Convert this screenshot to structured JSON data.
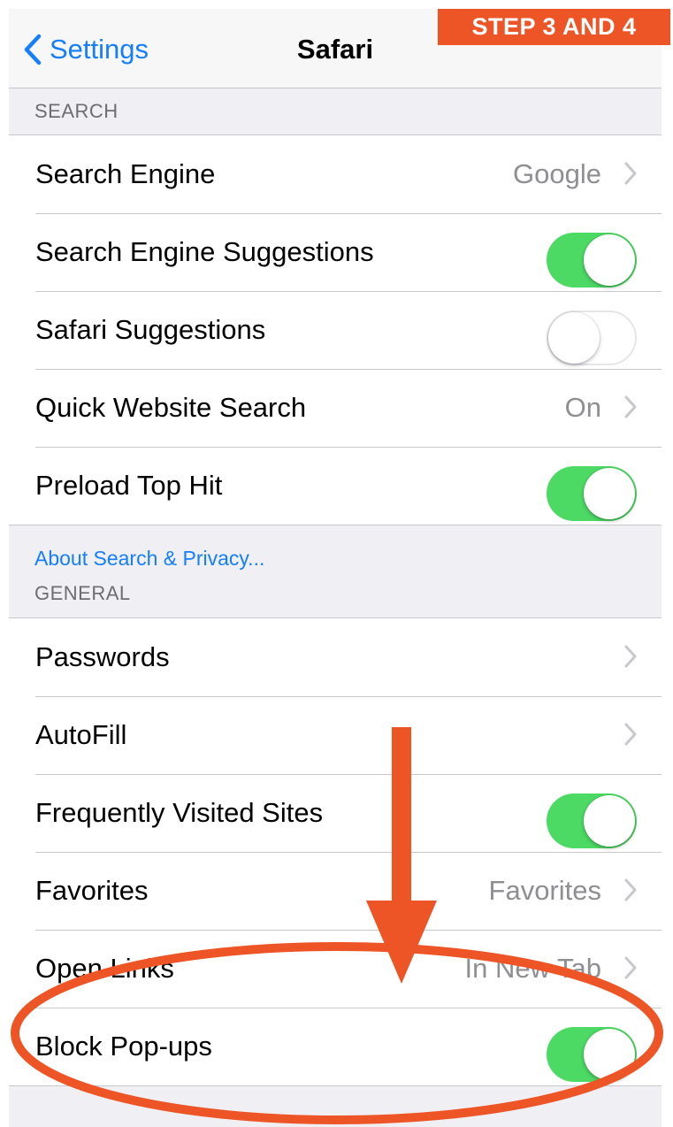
{
  "badge": "STEP 3 AND 4",
  "navbar": {
    "back_label": "Settings",
    "title": "Safari"
  },
  "search_section": {
    "header": "SEARCH",
    "rows": [
      {
        "label": "Search Engine",
        "value": "Google",
        "type": "disclosure"
      },
      {
        "label": "Search Engine Suggestions",
        "type": "toggle",
        "on": true
      },
      {
        "label": "Safari Suggestions",
        "type": "toggle",
        "on": false
      },
      {
        "label": "Quick Website Search",
        "value": "On",
        "type": "disclosure"
      },
      {
        "label": "Preload Top Hit",
        "type": "toggle",
        "on": true
      }
    ]
  },
  "about_link": "About Search & Privacy...",
  "general_section": {
    "header": "GENERAL",
    "rows": [
      {
        "label": "Passwords",
        "type": "disclosure"
      },
      {
        "label": "AutoFill",
        "type": "disclosure"
      },
      {
        "label": "Frequently Visited Sites",
        "type": "toggle",
        "on": true
      },
      {
        "label": "Favorites",
        "value": "Favorites",
        "type": "disclosure"
      },
      {
        "label": "Open Links",
        "value": "In New Tab",
        "type": "disclosure"
      },
      {
        "label": "Block Pop-ups",
        "type": "toggle",
        "on": true
      }
    ]
  },
  "colors": {
    "accent_blue": "#157efb",
    "toggle_on": "#4cd964",
    "annotation_orange": "#ee5526"
  },
  "icons": {
    "back": "chevron-left-icon",
    "disclosure": "chevron-right-icon"
  }
}
